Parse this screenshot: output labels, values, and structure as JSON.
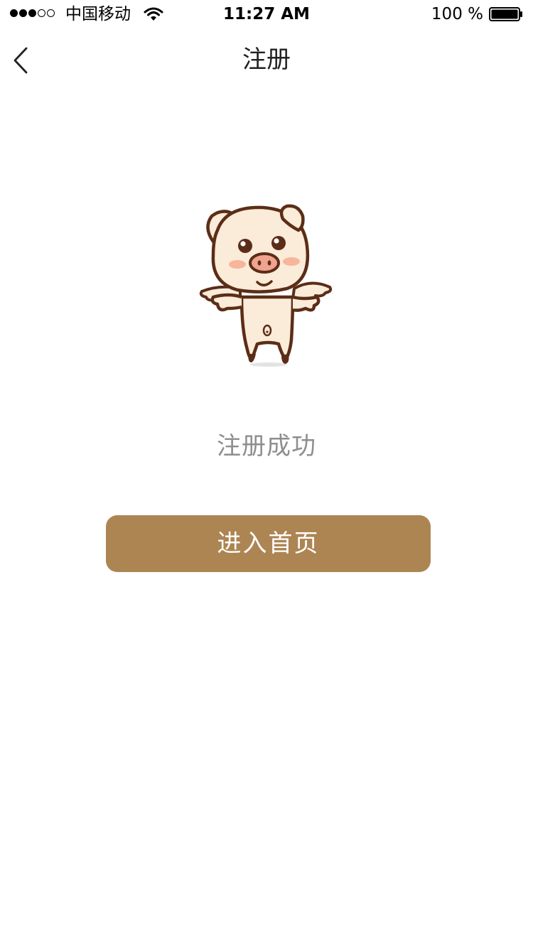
{
  "status_bar": {
    "signal_filled": 3,
    "signal_total": 5,
    "carrier": "中国移动",
    "time": "11:27 AM",
    "battery_text": "100 %",
    "battery_level": 1.0
  },
  "nav": {
    "title": "注册",
    "back_icon": "chevron-left-icon"
  },
  "content": {
    "mascot": "pig-mascot",
    "success_message": "注册成功",
    "enter_home_label": "进入首页"
  },
  "colors": {
    "accent": "#ad8553",
    "message_text": "#8e8e8e",
    "mascot_outline": "#5b2d17",
    "mascot_fill": "#fbebd9",
    "mascot_cheek": "#f7b59b"
  }
}
